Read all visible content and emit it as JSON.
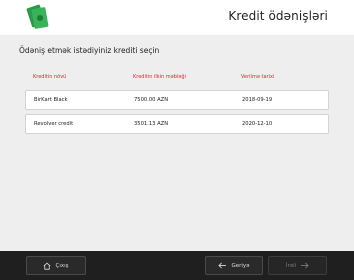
{
  "header": {
    "title": "Kredit ödənişləri",
    "logo_icon": "money-icon"
  },
  "main": {
    "prompt": "Ödəniş etmək istədiyiniz krediti seçin",
    "columns": [
      "Kreditin növü",
      "Kreditin ilkin məbləği",
      "Verilmə tarixi"
    ],
    "rows": [
      {
        "type": "BirKart Black",
        "amount": "7500.00 AZN",
        "date": "2018-09-19"
      },
      {
        "type": "Revolver credit",
        "amount": "3501.13 AZN",
        "date": "2020-12-10"
      }
    ]
  },
  "footer": {
    "exit_label": "Çıxış",
    "back_label": "Geriyə",
    "next_label": "İrəli"
  },
  "colors": {
    "accent": "#d52b2b",
    "footer_bg": "#1f1f1f",
    "logo_green": "#2fa84f"
  }
}
